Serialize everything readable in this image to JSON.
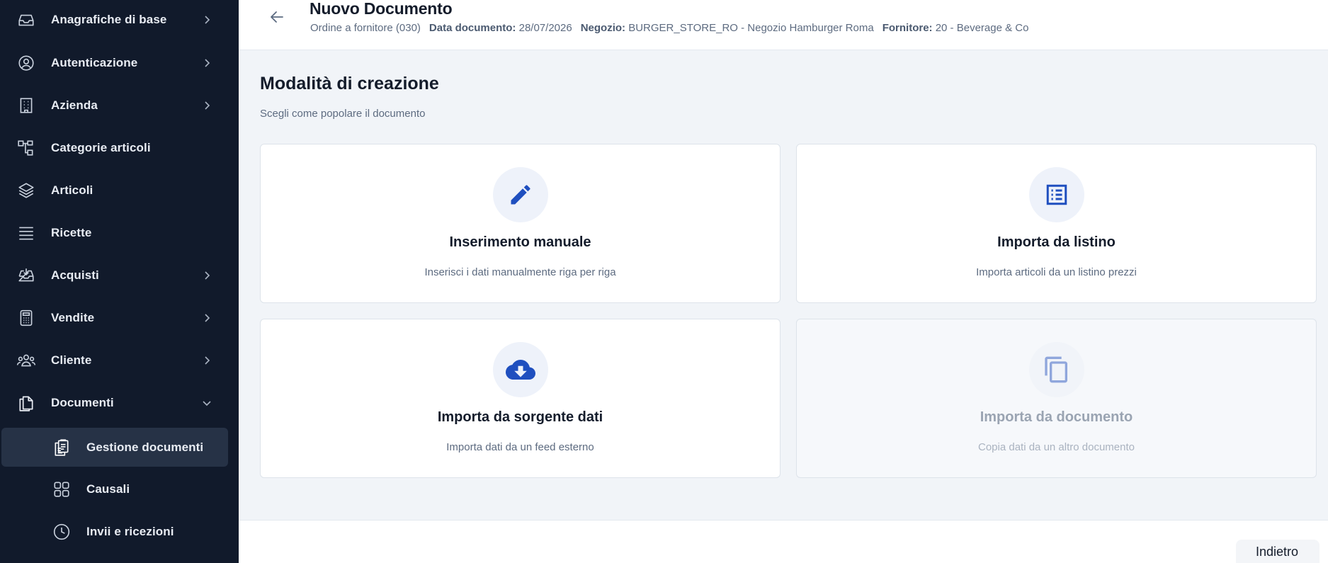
{
  "sidebar": {
    "items": [
      {
        "label": "Anagrafiche di base",
        "icon": "inbox-tray-icon",
        "has_chevron": true
      },
      {
        "label": "Autenticazione",
        "icon": "user-circle-icon",
        "has_chevron": true
      },
      {
        "label": "Azienda",
        "icon": "building-icon",
        "has_chevron": true
      },
      {
        "label": "Categorie articoli",
        "icon": "hierarchy-icon",
        "has_chevron": false
      },
      {
        "label": "Articoli",
        "icon": "layers-icon",
        "has_chevron": false
      },
      {
        "label": "Ricette",
        "icon": "list-lines-icon",
        "has_chevron": false
      },
      {
        "label": "Acquisti",
        "icon": "inbox-download-icon",
        "has_chevron": true
      },
      {
        "label": "Vendite",
        "icon": "calculator-icon",
        "has_chevron": true
      },
      {
        "label": "Cliente",
        "icon": "users-group-icon",
        "has_chevron": true
      },
      {
        "label": "Documenti",
        "icon": "documents-icon",
        "expanded": true
      }
    ],
    "subitems": [
      {
        "label": "Gestione documenti",
        "icon": "clipboard-docs-icon",
        "active": true
      },
      {
        "label": "Causali",
        "icon": "grid-icon",
        "active": false
      },
      {
        "label": "Invii e ricezioni",
        "icon": "clock-icon",
        "active": false
      }
    ]
  },
  "header": {
    "title": "Nuovo Documento",
    "doc_type": "Ordine a fornitore (030)",
    "date_key": "Data documento:",
    "date_value": "28/07/2026",
    "store_key": "Negozio:",
    "store_value": "BURGER_STORE_RO - Negozio Hamburger Roma",
    "supplier_key": "Fornitore:",
    "supplier_value": "20 - Beverage & Co"
  },
  "main": {
    "title": "Modalità di creazione",
    "subtitle": "Scegli come popolare il documento",
    "cards": [
      {
        "title": "Inserimento manuale",
        "description": "Inserisci i dati manualmente riga per riga",
        "icon": "pencil-icon",
        "enabled": true
      },
      {
        "title": "Importa da listino",
        "description": "Importa articoli da un listino prezzi",
        "icon": "list-document-icon",
        "enabled": true
      },
      {
        "title": "Importa da sorgente dati",
        "description": "Importa dati da un feed esterno",
        "icon": "cloud-download-icon",
        "enabled": true
      },
      {
        "title": "Importa da documento",
        "description": "Copia dati da un altro documento",
        "icon": "copy-icon",
        "enabled": false
      }
    ]
  },
  "footer": {
    "back_label": "Indietro"
  },
  "colors": {
    "sidebar_bg": "#111a2b",
    "sidebar_active_bg": "#263246",
    "accent_blue": "#1f4fbf",
    "page_bg": "#f1f4f8"
  }
}
